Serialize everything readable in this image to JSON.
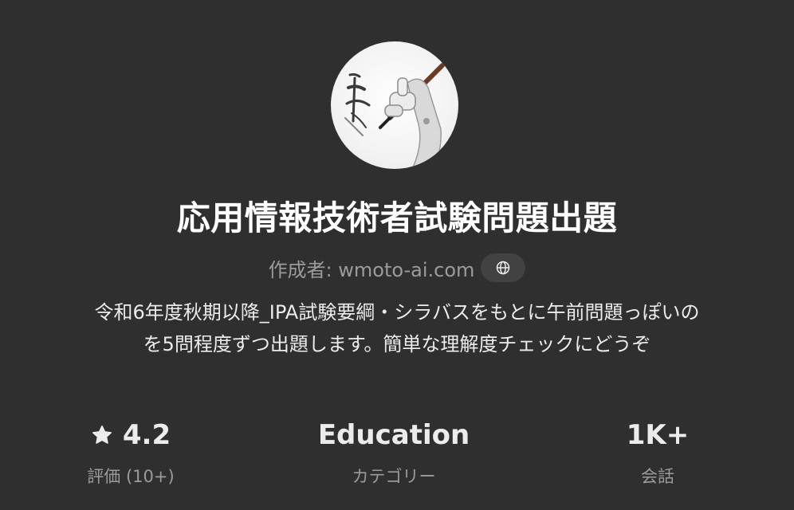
{
  "gpt": {
    "name": "応用情報技術者試験問題出題",
    "author": "作成者: wmoto-ai.com",
    "description_line1": "令和6年度秋期以降_IPA試験要綱・シラバスをもとに午前問題っぽいの",
    "description_line2": "を5問程度ずつ出題します。簡単な理解度チェックにどうぞ",
    "avatar_icon": "robot-calligraphy-avatar",
    "link_icon": "globe-icon"
  },
  "stats": {
    "rating": {
      "value": "4.2",
      "label": "評価 (10+)",
      "icon": "star-icon"
    },
    "category": {
      "value": "Education",
      "label": "カテゴリー"
    },
    "conversations": {
      "value": "1K+",
      "label": "会話"
    }
  },
  "colors": {
    "background": "#2f2f2f",
    "text": "#ececec",
    "muted": "#9b9b9b",
    "chip": "#424242"
  }
}
